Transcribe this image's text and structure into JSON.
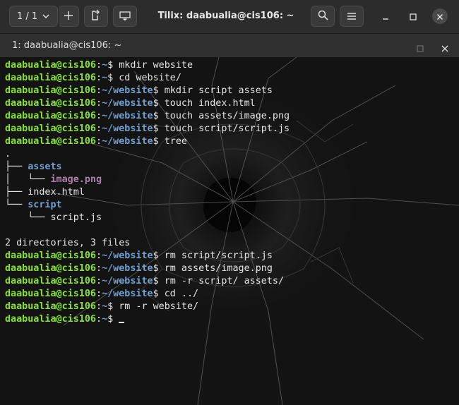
{
  "header": {
    "session_label": "1 / 1",
    "title": "Tilix: daabualia@cis106: ~"
  },
  "terminal": {
    "tab_title": "1: daabualia@cis106: ~",
    "user_host": "daabualia@cis106",
    "lines": [
      {
        "kind": "prompt",
        "path": "~",
        "cmd": "mkdir website"
      },
      {
        "kind": "prompt",
        "path": "~",
        "cmd": "cd website/"
      },
      {
        "kind": "prompt",
        "path": "~/website",
        "cmd": "mkdir script assets"
      },
      {
        "kind": "prompt",
        "path": "~/website",
        "cmd": "touch index.html"
      },
      {
        "kind": "prompt",
        "path": "~/website",
        "cmd": "touch assets/image.png"
      },
      {
        "kind": "prompt",
        "path": "~/website",
        "cmd": "touch script/script.js"
      },
      {
        "kind": "prompt",
        "path": "~/website",
        "cmd": "tree"
      },
      {
        "kind": "out",
        "segments": [
          {
            "t": "."
          }
        ]
      },
      {
        "kind": "out",
        "segments": [
          {
            "t": "├── "
          },
          {
            "t": "assets",
            "c": "dir"
          }
        ]
      },
      {
        "kind": "out",
        "segments": [
          {
            "t": "│   └── "
          },
          {
            "t": "image.png",
            "c": "img"
          }
        ]
      },
      {
        "kind": "out",
        "segments": [
          {
            "t": "├── index.html"
          }
        ]
      },
      {
        "kind": "out",
        "segments": [
          {
            "t": "└── "
          },
          {
            "t": "script",
            "c": "dir"
          }
        ]
      },
      {
        "kind": "out",
        "segments": [
          {
            "t": "    └── script.js"
          }
        ]
      },
      {
        "kind": "out",
        "segments": [
          {
            "t": ""
          }
        ]
      },
      {
        "kind": "out",
        "segments": [
          {
            "t": "2 directories, 3 files"
          }
        ]
      },
      {
        "kind": "prompt",
        "path": "~/website",
        "cmd": "rm script/script.js"
      },
      {
        "kind": "prompt",
        "path": "~/website",
        "cmd": "rm assets/image.png"
      },
      {
        "kind": "prompt",
        "path": "~/website",
        "cmd": "rm -r script/ assets/"
      },
      {
        "kind": "prompt",
        "path": "~/website",
        "cmd": "cd ../"
      },
      {
        "kind": "prompt",
        "path": "~",
        "cmd": "rm -r website/"
      },
      {
        "kind": "prompt",
        "path": "~",
        "cmd": "",
        "cursor": true
      }
    ]
  },
  "colors": {
    "user_host": "#8ae234",
    "path": "#729fcf",
    "directory": "#729fcf",
    "image_file": "#ad7fa8",
    "background": "#121212"
  },
  "icons": [
    "chevron-down-icon",
    "add-icon",
    "attach-icon",
    "split-icon",
    "search-icon",
    "hamburger-menu-icon",
    "minimize-icon",
    "maximize-icon",
    "close-icon"
  ]
}
